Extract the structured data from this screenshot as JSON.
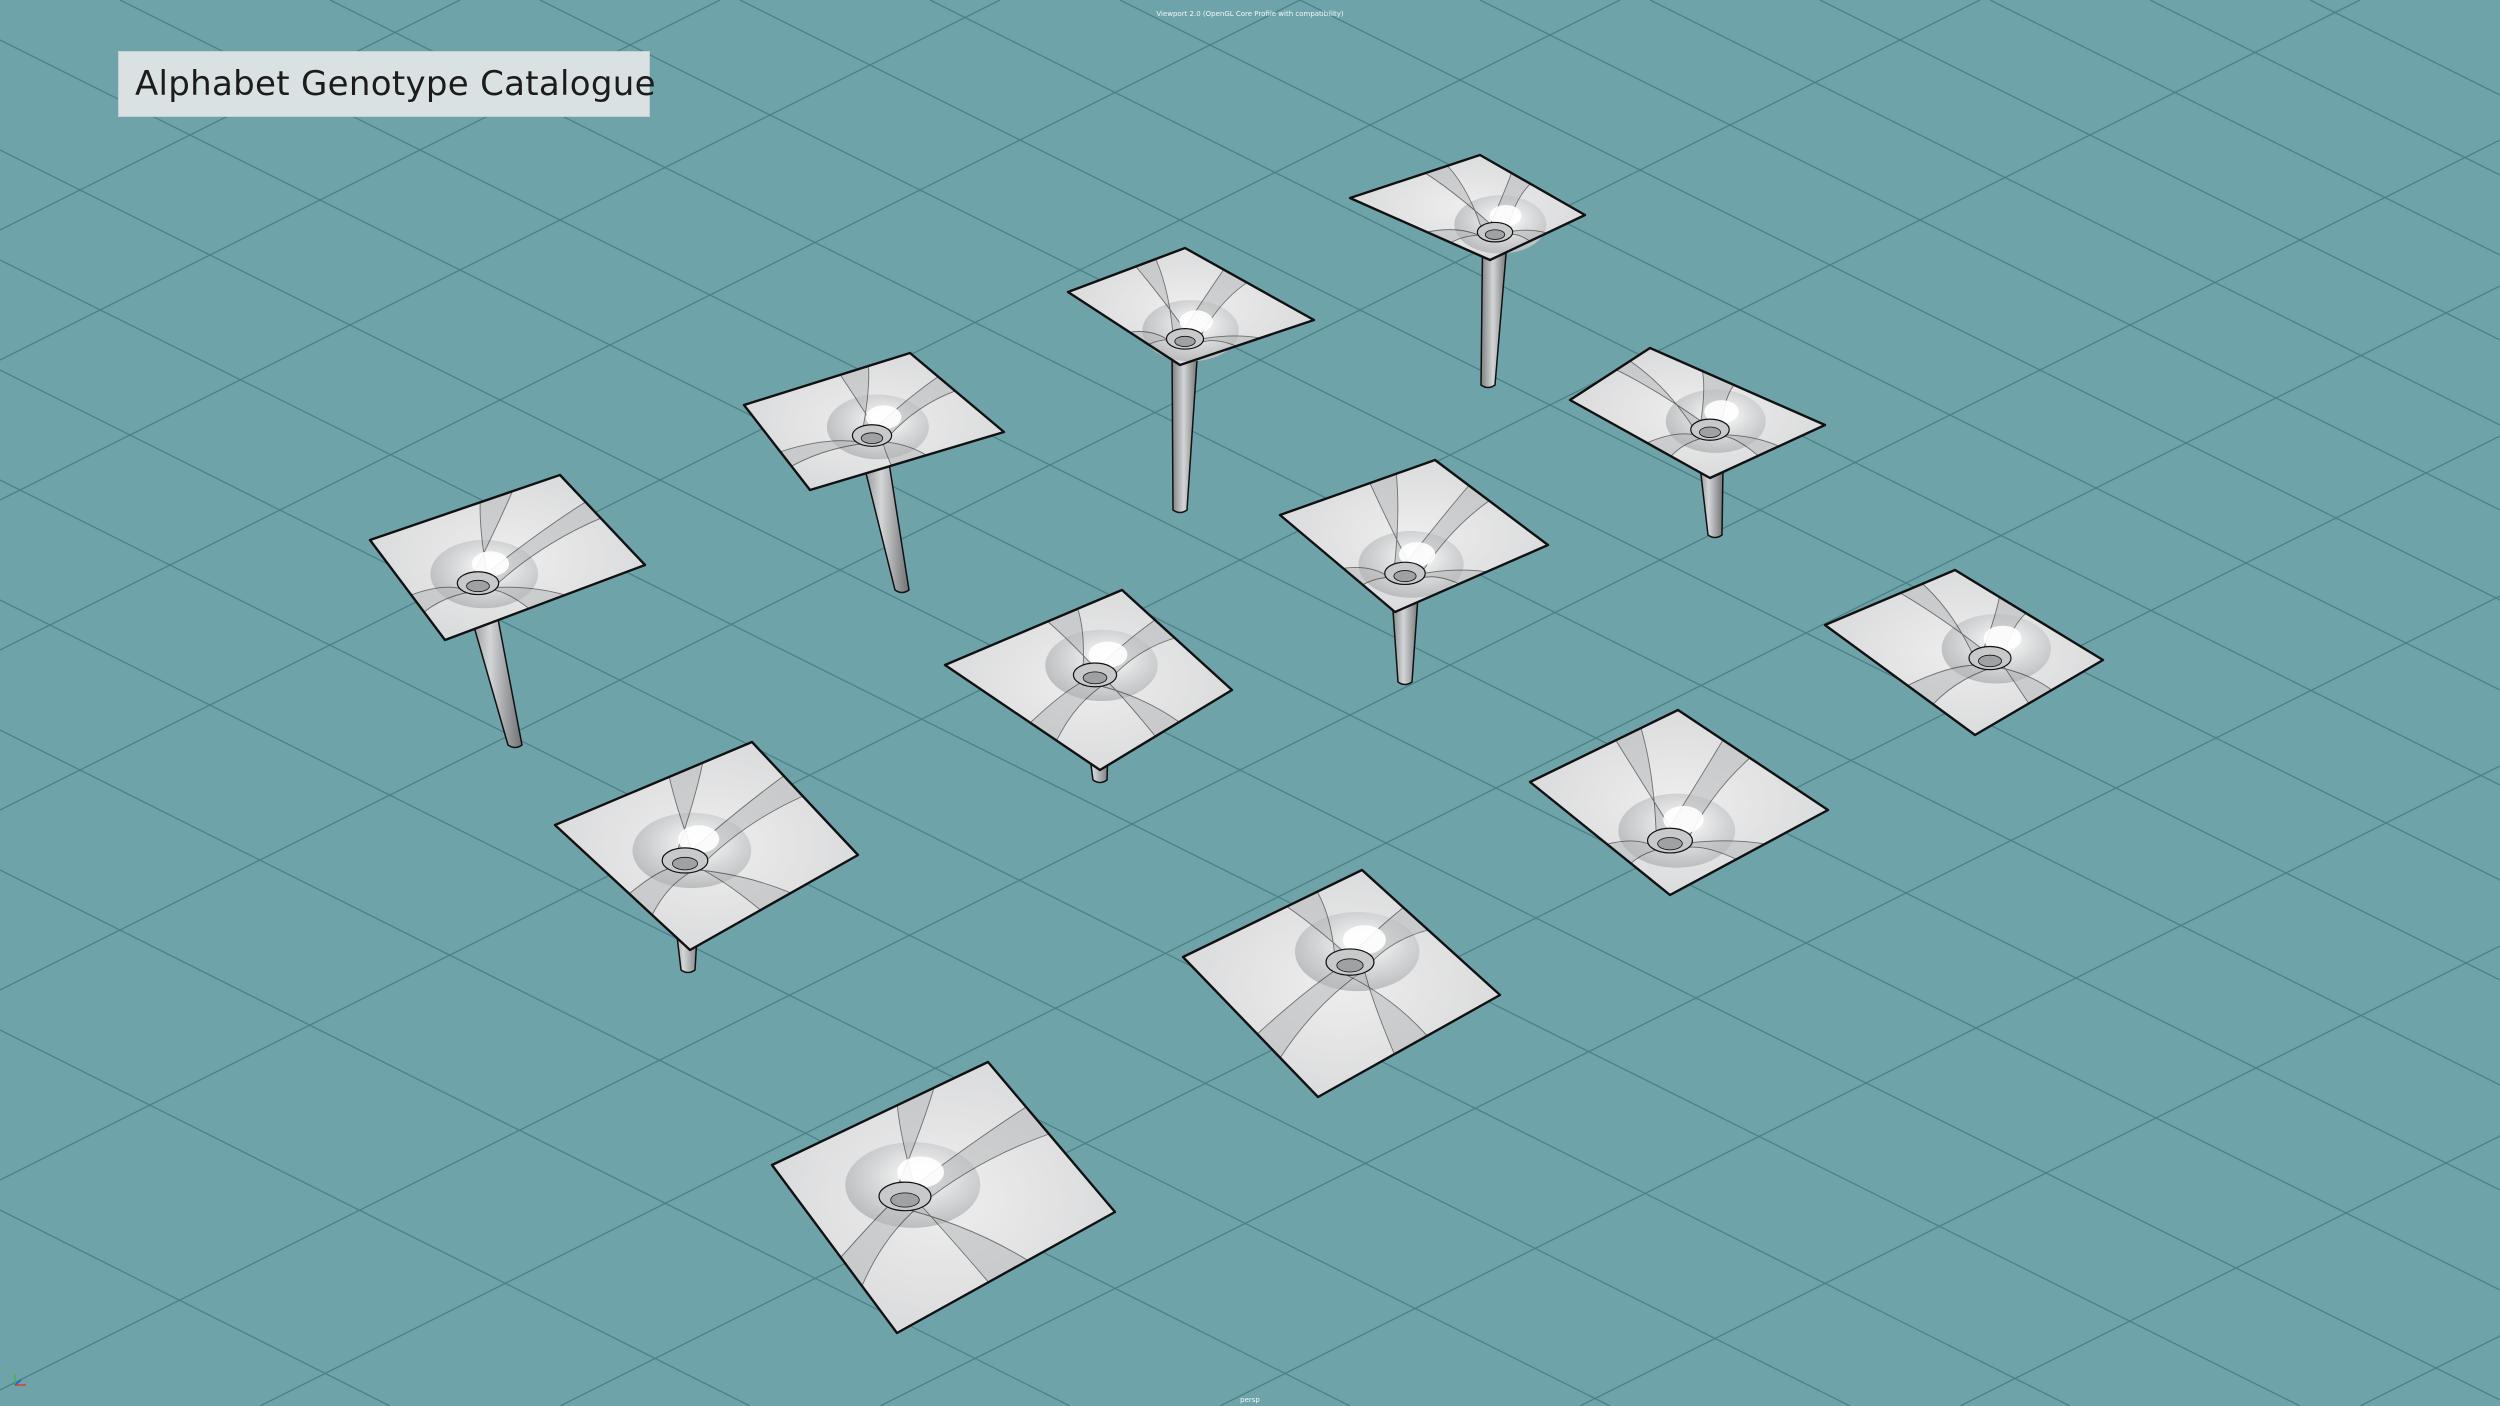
{
  "viewport": {
    "header_text": "Viewport 2.0 (OpenGL Core Profile with compatibility)",
    "camera_label": "persp",
    "background_color": "#6fa3aa",
    "grid_color": "#4d8188",
    "surface_color": "#dedfe0",
    "edge_color": "#111111"
  },
  "catalogue": {
    "title": "Alphabet Genotype Catalogue",
    "genotype_count": 12
  },
  "icons": {
    "axis": "axis-gizmo-icon"
  }
}
